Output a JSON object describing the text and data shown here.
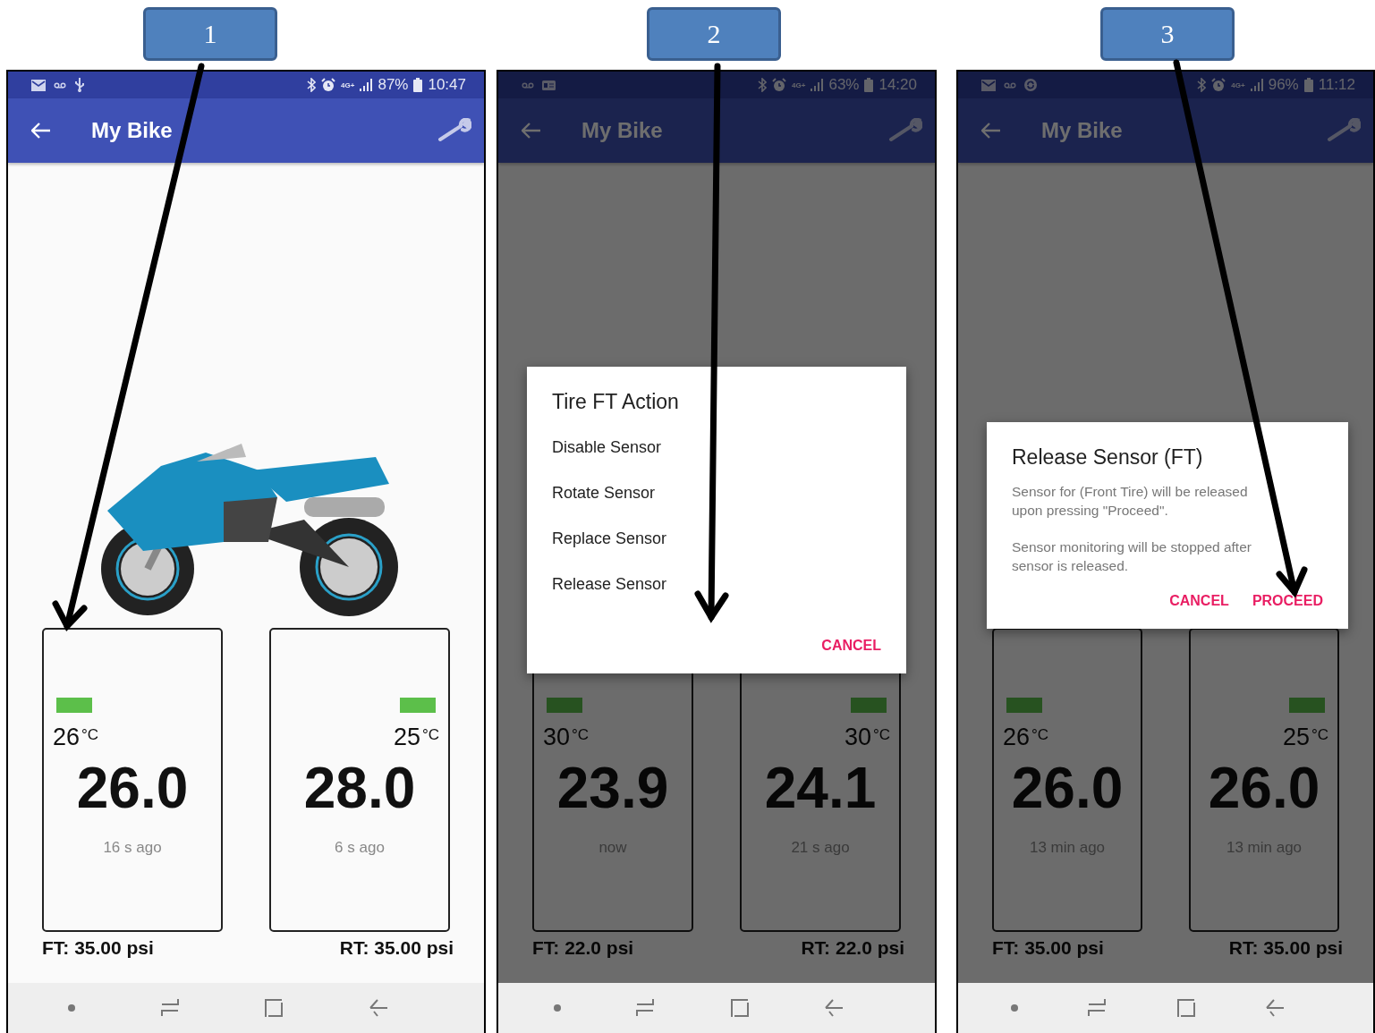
{
  "panels": [
    {
      "callout": "1",
      "status_bar": {
        "notifications": [
          {
            "kind": "mail"
          },
          {
            "kind": "voicemail"
          },
          {
            "kind": "usb"
          }
        ],
        "network": "4G+",
        "battery": "87%",
        "time": "10:47"
      },
      "app_bar": {
        "title": "My Bike"
      },
      "tires": [
        {
          "temperature": "26",
          "temp_unit": "°C",
          "pressure": "26.0",
          "updated": "16 s ago",
          "label": "FT: 35.00 psi"
        },
        {
          "temperature": "25",
          "temp_unit": "°C",
          "pressure": "28.0",
          "updated": "6 s ago",
          "label": "RT: 35.00 psi"
        }
      ]
    },
    {
      "callout": "2",
      "status_bar": {
        "notifications": [
          {
            "kind": "voicemail"
          },
          {
            "kind": "card"
          }
        ],
        "network": "4G+",
        "battery": "63%",
        "time": "14:20"
      },
      "app_bar": {
        "title": "My Bike"
      },
      "tires": [
        {
          "temperature": "30",
          "temp_unit": "°C",
          "pressure": "23.9",
          "updated": "now",
          "label": "FT: 22.0 psi"
        },
        {
          "temperature": "30",
          "temp_unit": "°C",
          "pressure": "24.1",
          "updated": "21 s ago",
          "label": "RT: 22.0 psi"
        }
      ],
      "dialog": {
        "title": "Tire FT Action",
        "options": [
          "Disable Sensor",
          "Rotate Sensor",
          "Replace Sensor",
          "Release Sensor"
        ],
        "buttons": [
          "CANCEL"
        ]
      }
    },
    {
      "callout": "3",
      "status_bar": {
        "notifications": [
          {
            "kind": "mail"
          },
          {
            "kind": "voicemail"
          },
          {
            "kind": "sync"
          }
        ],
        "network": "4G+",
        "battery": "96%",
        "time": "11:12"
      },
      "app_bar": {
        "title": "My Bike"
      },
      "tires": [
        {
          "temperature": "26",
          "temp_unit": "°C",
          "pressure": "26.0",
          "updated": "13 min ago",
          "label": "FT: 35.00 psi"
        },
        {
          "temperature": "25",
          "temp_unit": "°C",
          "pressure": "26.0",
          "updated": "13 min ago",
          "label": "RT: 35.00 psi"
        }
      ],
      "dialog": {
        "title": "Release Sensor (FT)",
        "paragraphs": [
          "Sensor for (Front Tire) will be released upon pressing \"Proceed\".",
          "Sensor monitoring will be stopped after sensor is released."
        ],
        "buttons": [
          "CANCEL",
          "PROCEED"
        ]
      }
    }
  ]
}
